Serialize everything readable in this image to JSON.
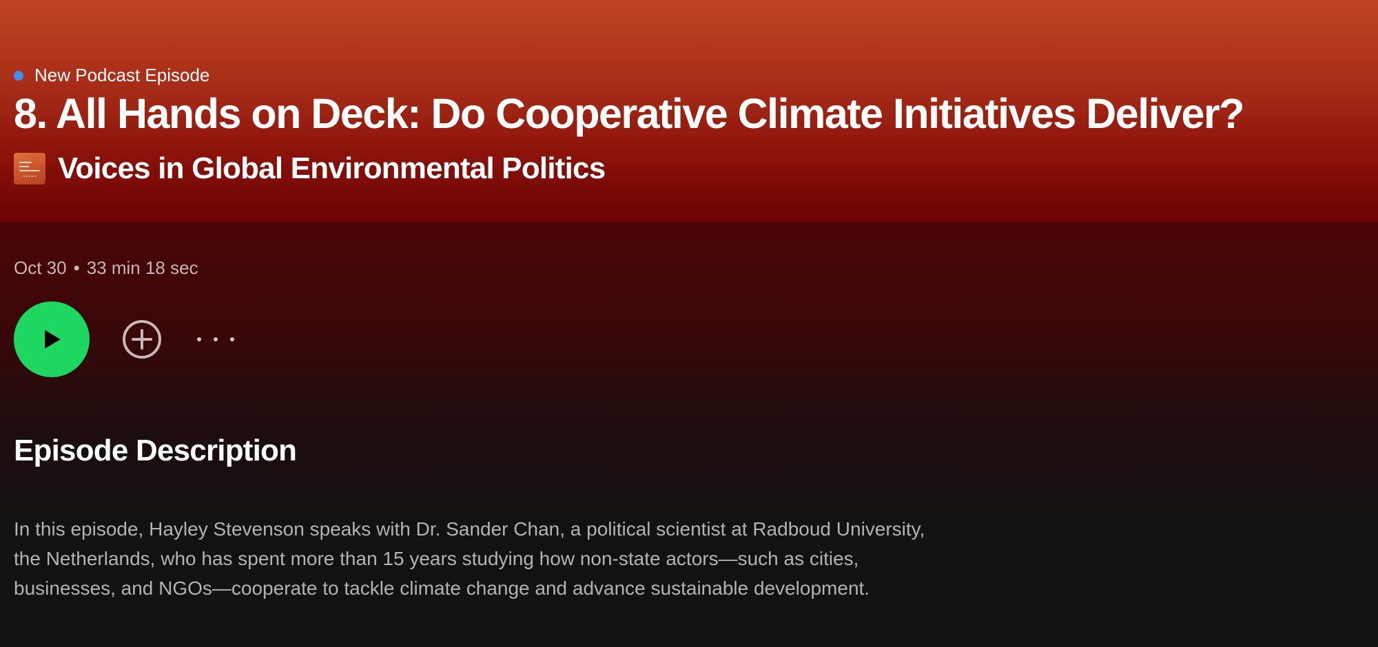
{
  "episode": {
    "kicker": "New Podcast Episode",
    "title": "8. All Hands on Deck: Do Cooperative Climate Initiatives Deliver?",
    "show_name": "Voices in Global Environmental Politics",
    "date": "Oct 30",
    "separator": "•",
    "duration": "33 min 18 sec"
  },
  "controls": {
    "play_icon": "play-icon",
    "add_icon": "plus-circle-icon",
    "more_icon": "more-horizontal-icon"
  },
  "description": {
    "heading": "Episode Description",
    "body": "In this episode, Hayley Stevenson speaks with Dr. Sander Chan, a political scientist at Radboud University, the Netherlands, who has spent more than 15 years studying how non-state actors—such as cities, businesses, and NGOs—cooperate to tackle climate change and advance sustainable development."
  },
  "colors": {
    "accent_green": "#1ed760",
    "kicker_dot_blue": "#3d91f4",
    "hero_top": "#bf4524",
    "hero_bottom": "#6c0203",
    "page_background": "#121212"
  }
}
